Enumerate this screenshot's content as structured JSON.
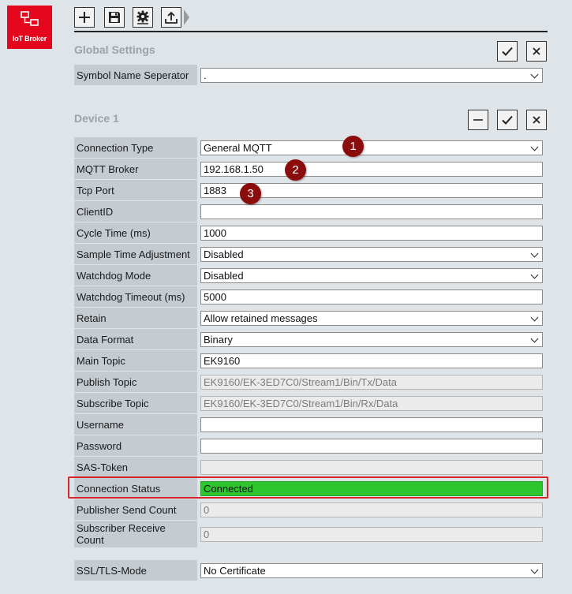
{
  "brand": {
    "label": "IoT Broker"
  },
  "toolbar": {
    "buttons": [
      "add-icon",
      "save-icon",
      "settings-icon",
      "upload-icon"
    ]
  },
  "global_settings": {
    "title": "Global Settings",
    "rows": [
      {
        "label": "Symbol Name Seperator",
        "value": ".",
        "kind": "select"
      }
    ]
  },
  "device": {
    "title": "Device 1",
    "rows": [
      {
        "label": "Connection Type",
        "value": "General MQTT",
        "kind": "select"
      },
      {
        "label": "MQTT Broker",
        "value": "192.168.1.50",
        "kind": "text"
      },
      {
        "label": "Tcp Port",
        "value": "1883",
        "kind": "text"
      },
      {
        "label": "ClientID",
        "value": "",
        "kind": "text"
      },
      {
        "label": "Cycle Time (ms)",
        "value": "1000",
        "kind": "text"
      },
      {
        "label": "Sample Time Adjustment",
        "value": "Disabled",
        "kind": "select"
      },
      {
        "label": "Watchdog Mode",
        "value": "Disabled",
        "kind": "select"
      },
      {
        "label": "Watchdog Timeout (ms)",
        "value": "5000",
        "kind": "text"
      },
      {
        "label": "Retain",
        "value": "Allow retained messages",
        "kind": "select"
      },
      {
        "label": "Data Format",
        "value": "Binary",
        "kind": "select"
      },
      {
        "label": "Main Topic",
        "value": "EK9160",
        "kind": "text"
      },
      {
        "label": "Publish Topic",
        "value": "EK9160/EK-3ED7C0/Stream1/Bin/Tx/Data",
        "kind": "disabled"
      },
      {
        "label": "Subscribe Topic",
        "value": "EK9160/EK-3ED7C0/Stream1/Bin/Rx/Data",
        "kind": "disabled"
      },
      {
        "label": "Username",
        "value": "",
        "kind": "text"
      },
      {
        "label": "Password",
        "value": "",
        "kind": "text"
      },
      {
        "label": "SAS-Token",
        "value": "",
        "kind": "disabled"
      },
      {
        "label": "Connection Status",
        "value": "Connected",
        "kind": "status"
      },
      {
        "label": "Publisher Send Count",
        "value": "0",
        "kind": "disabled"
      },
      {
        "label": "Subscriber Receive Count",
        "value": "0",
        "kind": "disabled"
      }
    ],
    "ssl": {
      "label": "SSL/TLS-Mode",
      "value": "No Certificate",
      "kind": "select"
    }
  },
  "callouts": [
    "1",
    "2",
    "3"
  ],
  "colors": {
    "brand": "#e4061c",
    "connected": "#2fc52f",
    "highlight": "#d6262b",
    "callout": "#8b0c0c"
  }
}
